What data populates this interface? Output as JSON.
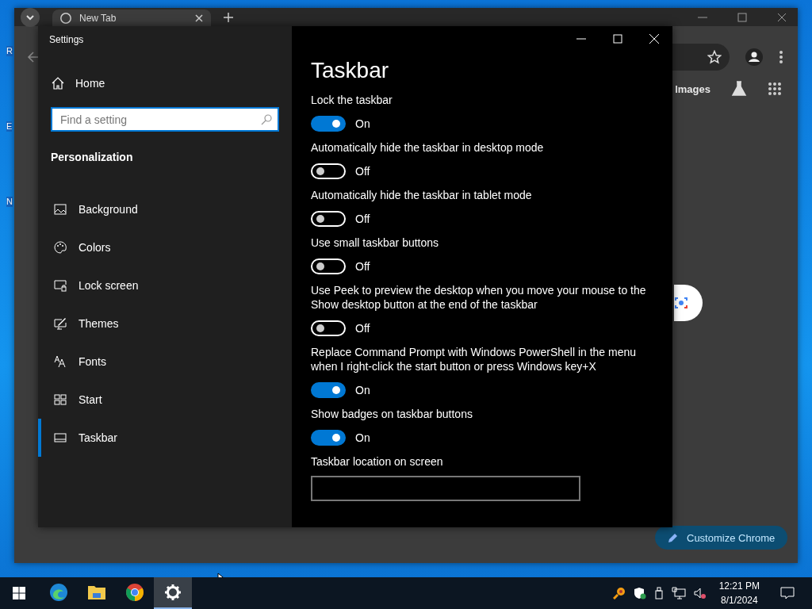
{
  "desktop": {
    "icon_labels": [
      "R",
      "E",
      "N"
    ]
  },
  "browser": {
    "tab": {
      "title": "New Tab"
    },
    "header_link": "Images",
    "customize_button": "Customize Chrome"
  },
  "settings": {
    "title": "Settings",
    "home": "Home",
    "search": {
      "placeholder": "Find a setting"
    },
    "section": "Personalization",
    "nav": [
      {
        "kind": "background",
        "label": "Background",
        "selected": false
      },
      {
        "kind": "colors",
        "label": "Colors",
        "selected": false
      },
      {
        "kind": "lock",
        "label": "Lock screen",
        "selected": false
      },
      {
        "kind": "themes",
        "label": "Themes",
        "selected": false
      },
      {
        "kind": "fonts",
        "label": "Fonts",
        "selected": false
      },
      {
        "kind": "start",
        "label": "Start",
        "selected": false
      },
      {
        "kind": "taskbar",
        "label": "Taskbar",
        "selected": true
      }
    ],
    "page_title": "Taskbar",
    "options": [
      {
        "label": "Lock the taskbar",
        "on": true,
        "state_text": "On"
      },
      {
        "label": "Automatically hide the taskbar in desktop mode",
        "on": false,
        "state_text": "Off"
      },
      {
        "label": "Automatically hide the taskbar in tablet mode",
        "on": false,
        "state_text": "Off"
      },
      {
        "label": "Use small taskbar buttons",
        "on": false,
        "state_text": "Off"
      },
      {
        "label": "Use Peek to preview the desktop when you move your mouse to the Show desktop button at the end of the taskbar",
        "on": false,
        "state_text": "Off"
      },
      {
        "label": "Replace Command Prompt with Windows PowerShell in the menu when I right-click the start button or press Windows key+X",
        "on": true,
        "state_text": "On"
      },
      {
        "label": "Show badges on taskbar buttons",
        "on": true,
        "state_text": "On"
      }
    ],
    "last_setting": "Taskbar location on screen"
  },
  "taskbar": {
    "apps": [
      {
        "kind": "edge",
        "active": false
      },
      {
        "kind": "explorer",
        "active": false
      },
      {
        "kind": "chrome",
        "active": false
      },
      {
        "kind": "settings",
        "active": true
      }
    ],
    "clock": {
      "time": "12:21 PM",
      "date": "8/1/2024"
    }
  }
}
